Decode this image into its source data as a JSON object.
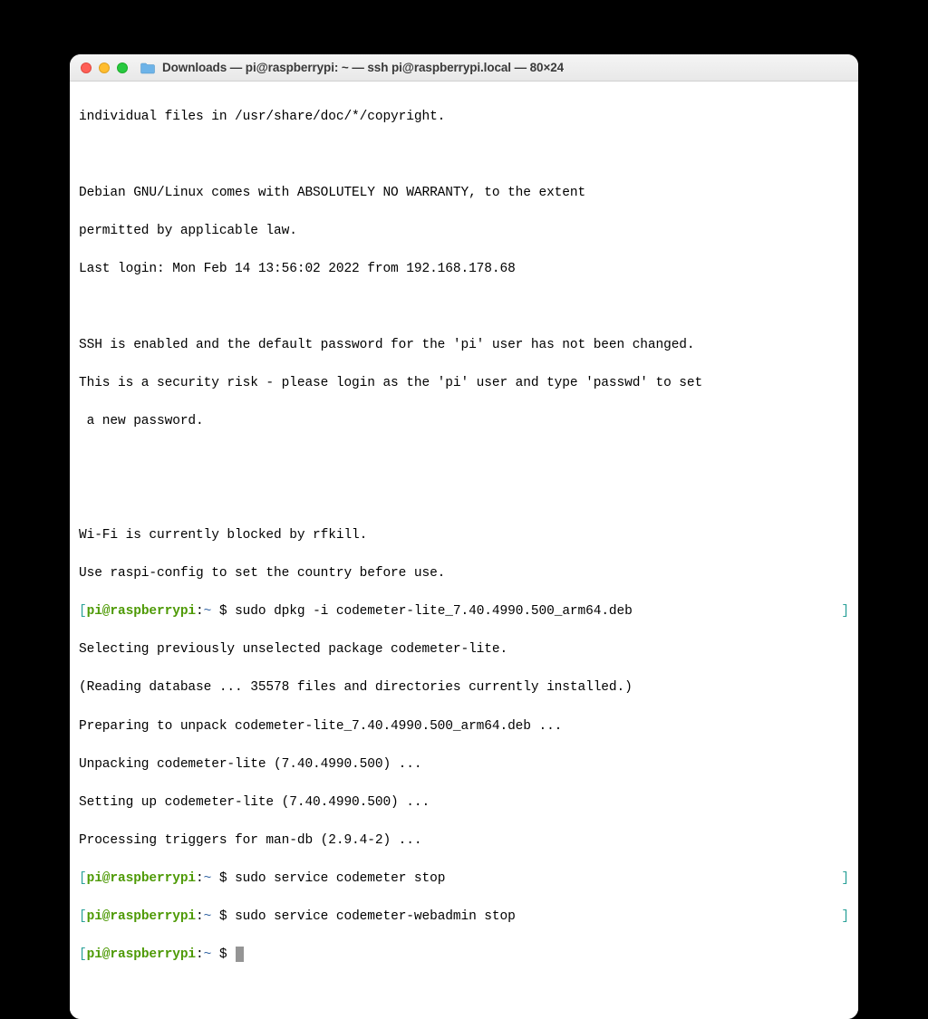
{
  "window": {
    "title": "Downloads — pi@raspberrypi: ~ — ssh pi@raspberrypi.local — 80×24"
  },
  "colors": {
    "close": "#ff5f57",
    "minimize": "#ffbd2e",
    "zoom": "#28c940",
    "prompt_user": "#4e9a06",
    "prompt_bracket": "#2aa198",
    "prompt_path": "#3465a4"
  },
  "prompt": {
    "open_bracket": "[",
    "user_host": "pi@raspberrypi",
    "colon": ":",
    "path": "~",
    "dollar": " $ ",
    "close_bracket": "]"
  },
  "motd": {
    "l1": "individual files in /usr/share/doc/*/copyright.",
    "l2": "",
    "l3": "Debian GNU/Linux comes with ABSOLUTELY NO WARRANTY, to the extent",
    "l4": "permitted by applicable law.",
    "l5": "Last login: Mon Feb 14 13:56:02 2022 from 192.168.178.68",
    "l6": "",
    "l7": "SSH is enabled and the default password for the 'pi' user has not been changed.",
    "l8": "This is a security risk - please login as the 'pi' user and type 'passwd' to set",
    "l9": " a new password.",
    "l10": "",
    "l11": "",
    "l12": "Wi-Fi is currently blocked by rfkill.",
    "l13": "Use raspi-config to set the country before use."
  },
  "commands": {
    "c1": "sudo dpkg -i codemeter-lite_7.40.4990.500_arm64.deb",
    "c2": "sudo service codemeter stop",
    "c3": "sudo service codemeter-webadmin stop",
    "c4": ""
  },
  "output": {
    "o1": "Selecting previously unselected package codemeter-lite.",
    "o2": "(Reading database ... 35578 files and directories currently installed.)",
    "o3": "Preparing to unpack codemeter-lite_7.40.4990.500_arm64.deb ...",
    "o4": "Unpacking codemeter-lite (7.40.4990.500) ...",
    "o5": "Setting up codemeter-lite (7.40.4990.500) ...",
    "o6": "Processing triggers for man-db (2.9.4-2) ..."
  }
}
